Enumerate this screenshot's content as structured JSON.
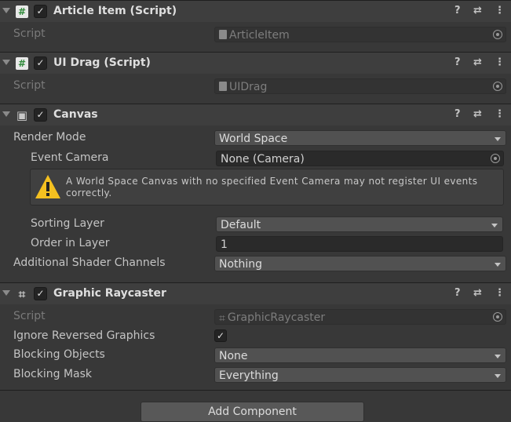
{
  "components": [
    {
      "title": "Article Item (Script)",
      "icon": "script-icon",
      "script_label": "Script",
      "script_value": "ArticleItem"
    },
    {
      "title": "UI Drag (Script)",
      "icon": "script-icon",
      "script_label": "Script",
      "script_value": "UIDrag"
    },
    {
      "title": "Canvas",
      "icon": "canvas-icon"
    },
    {
      "title": "Graphic Raycaster",
      "icon": "raycaster-icon"
    }
  ],
  "canvas": {
    "render_mode_label": "Render Mode",
    "render_mode_value": "World Space",
    "event_camera_label": "Event Camera",
    "event_camera_value": "None (Camera)",
    "warning": "A World Space Canvas with no specified Event Camera may not register UI events correctly.",
    "sorting_layer_label": "Sorting Layer",
    "sorting_layer_value": "Default",
    "order_label": "Order in Layer",
    "order_value": "1",
    "shader_label": "Additional Shader Channels",
    "shader_value": "Nothing"
  },
  "raycaster": {
    "script_label": "Script",
    "script_value": "GraphicRaycaster",
    "ignore_label": "Ignore Reversed Graphics",
    "ignore_checked": true,
    "blocking_objects_label": "Blocking Objects",
    "blocking_objects_value": "None",
    "blocking_mask_label": "Blocking Mask",
    "blocking_mask_value": "Everything"
  },
  "add_component_label": "Add Component",
  "header_icons": {
    "help": "?",
    "preset": "⇄",
    "more": "⋮"
  }
}
